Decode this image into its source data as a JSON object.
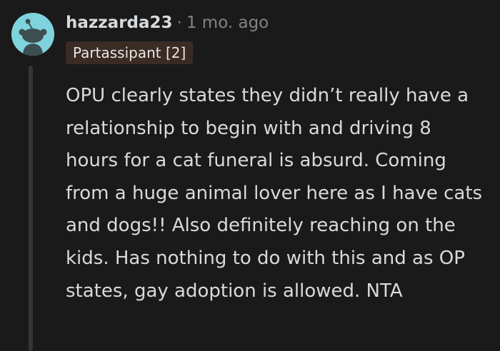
{
  "comment": {
    "username": "hazzarda23",
    "separator": "·",
    "timestamp": "1 mo. ago",
    "flair": "Partassipant [2]",
    "body": "OPU clearly states they didn’t really have a relationship to begin with and driving 8 hours for a cat funeral is absurd. Coming from a huge animal lover here as I have cats and dogs!! Also definitely reaching on the kids. Has nothing to do with this and as OP states, gay adoption is allowed. NTA",
    "avatar_icon": "snoo-avatar-icon"
  },
  "colors": {
    "background": "#1a1a1b",
    "text": "#d7dadc",
    "meta": "#818384",
    "avatar_bg": "#7fd3dc",
    "flair_bg": "#3a2b25"
  }
}
